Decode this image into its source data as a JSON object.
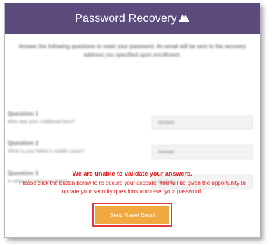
{
  "header": {
    "title": "Password Recovery",
    "logo": "wave-brand-logo",
    "color": "#5b4a7c"
  },
  "intro": "Answer the following questions to reset your password. An email will be sent to the recovery address you specified upon enrollment.",
  "questions": [
    {
      "title": "Question 1",
      "text": "Who was your childhood hero?",
      "answer_placeholder": "Answer"
    },
    {
      "title": "Question 2",
      "text": "What is your father's middle name?",
      "answer_placeholder": "Answer"
    },
    {
      "title": "Question 3",
      "text": "In what city were you born?",
      "answer_placeholder": "Answer"
    }
  ],
  "error": {
    "title": "We are unable to validate your answers.",
    "body": "Please click the button below to re-secure your account. You will be given the opportunity to update your security questions and reset your password.",
    "color": "#e11818"
  },
  "send_button": {
    "label": "Send Reset Email",
    "color": "#f0a840",
    "highlight_color": "#e03a3a"
  }
}
